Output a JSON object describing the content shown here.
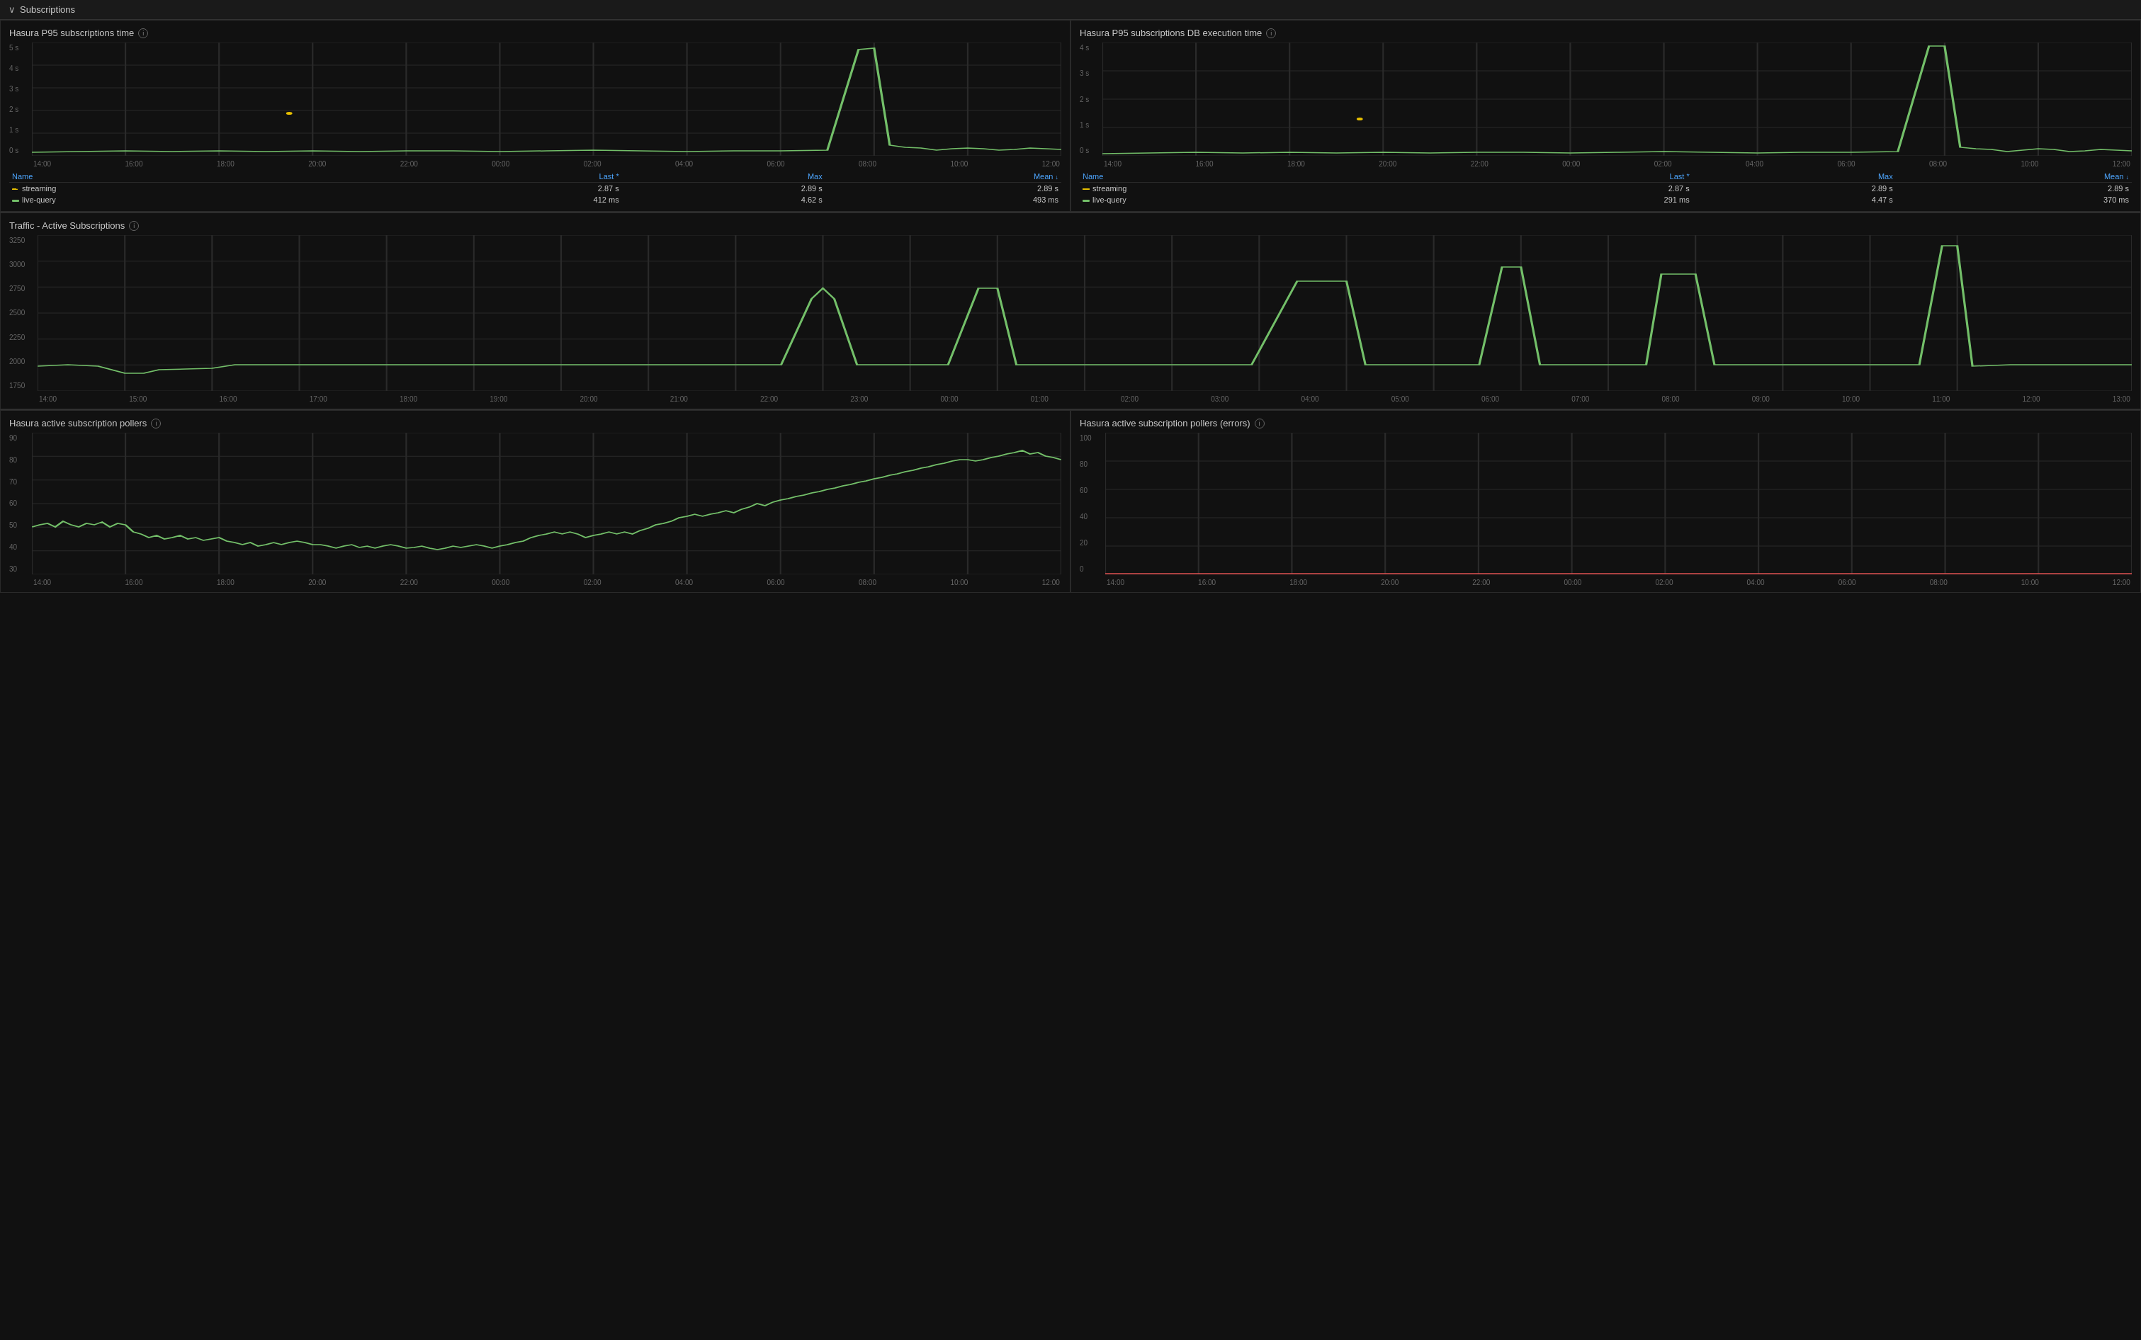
{
  "section": {
    "title": "Subscriptions",
    "chevron": "∨"
  },
  "panel1": {
    "title": "Hasura P95 subscriptions time",
    "yLabels": [
      "5 s",
      "4 s",
      "3 s",
      "2 s",
      "1 s",
      "0 s"
    ],
    "xLabels": [
      "14:00",
      "16:00",
      "18:00",
      "20:00",
      "22:00",
      "00:00",
      "02:00",
      "04:00",
      "06:00",
      "08:00",
      "10:00",
      "12:00"
    ],
    "columns": {
      "name": "Name",
      "last": "Last *",
      "max": "Max",
      "mean": "Mean"
    },
    "rows": [
      {
        "color": "#e8c000",
        "dash": true,
        "name": "streaming",
        "last": "2.87 s",
        "max": "2.89 s",
        "mean": "2.89 s"
      },
      {
        "color": "#73bf69",
        "dash": false,
        "name": "live-query",
        "last": "412 ms",
        "max": "4.62 s",
        "mean": "493 ms"
      }
    ]
  },
  "panel2": {
    "title": "Hasura P95 subscriptions DB execution time",
    "yLabels": [
      "4 s",
      "3 s",
      "2 s",
      "1 s",
      "0 s"
    ],
    "xLabels": [
      "14:00",
      "16:00",
      "18:00",
      "20:00",
      "22:00",
      "00:00",
      "02:00",
      "04:00",
      "06:00",
      "08:00",
      "10:00",
      "12:00"
    ],
    "columns": {
      "name": "Name",
      "last": "Last *",
      "max": "Max",
      "mean": "Mean"
    },
    "rows": [
      {
        "color": "#e8c000",
        "dash": true,
        "name": "streaming",
        "last": "2.87 s",
        "max": "2.89 s",
        "mean": "2.89 s"
      },
      {
        "color": "#73bf69",
        "dash": false,
        "name": "live-query",
        "last": "291 ms",
        "max": "4.47 s",
        "mean": "370 ms"
      }
    ]
  },
  "panel3": {
    "title": "Traffic - Active Subscriptions",
    "yLabels": [
      "3250",
      "3000",
      "2750",
      "2500",
      "2250",
      "2000",
      "1750"
    ],
    "xLabels": [
      "14:00",
      "15:00",
      "16:00",
      "17:00",
      "18:00",
      "19:00",
      "20:00",
      "21:00",
      "22:00",
      "23:00",
      "00:00",
      "01:00",
      "02:00",
      "03:00",
      "04:00",
      "05:00",
      "06:00",
      "07:00",
      "08:00",
      "09:00",
      "10:00",
      "11:00",
      "12:00",
      "13:00"
    ]
  },
  "panel4": {
    "title": "Hasura active subscription pollers",
    "yLabels": [
      "90",
      "80",
      "70",
      "60",
      "50",
      "40",
      "30"
    ],
    "xLabels": [
      "14:00",
      "16:00",
      "18:00",
      "20:00",
      "22:00",
      "00:00",
      "02:00",
      "04:00",
      "06:00",
      "08:00",
      "10:00",
      "12:00"
    ]
  },
  "panel5": {
    "title": "Hasura active subscription pollers (errors)",
    "yLabels": [
      "100",
      "80",
      "60",
      "40",
      "20",
      "0"
    ],
    "xLabels": [
      "14:00",
      "16:00",
      "18:00",
      "20:00",
      "22:00",
      "00:00",
      "02:00",
      "04:00",
      "06:00",
      "08:00",
      "10:00",
      "12:00"
    ]
  },
  "icons": {
    "info": "i",
    "sort_desc": "↓"
  }
}
